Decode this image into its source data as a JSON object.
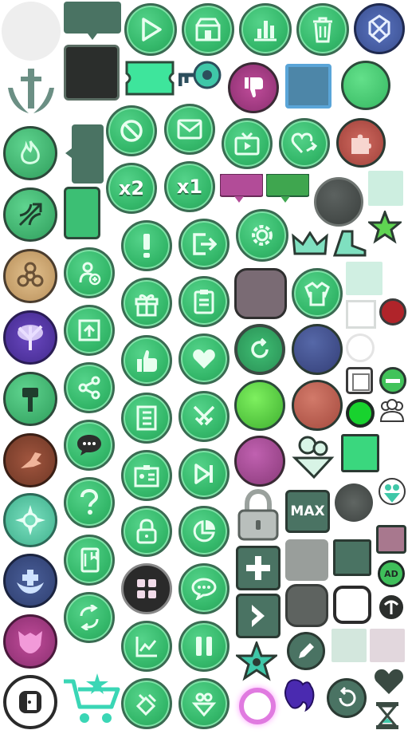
{
  "labels": {
    "x2": "x2",
    "x1": "x1",
    "max": "MAX",
    "ad": "AD"
  },
  "colors": {
    "green": "#3cbf74",
    "green_border": "#3a6b52",
    "dark_slate": "#4a7363",
    "charcoal": "#2b2e2c",
    "magenta": "#b24c98",
    "blue_frame": "#5aa5d8",
    "red_puzzle": "#c45a50",
    "tan": "#caa877",
    "purple": "#5a3aa8",
    "brown": "#8a4a35",
    "teal": "#5bc9a8",
    "navy": "#40518c",
    "pink": "#e98ad0"
  },
  "icons": [
    "circle-placeholder-icon",
    "sword-emblem-icon",
    "fire-icon",
    "bow-icon",
    "biohazard-icon",
    "tree-icon",
    "hammer-icon",
    "claw-icon",
    "sun-icon",
    "heal-icon",
    "helmet-icon",
    "exit-icon",
    "play-icon",
    "shop-icon",
    "chart-icon",
    "trash-icon",
    "guild-emblem-icon",
    "ticket-icon",
    "key-icon",
    "thumbs-down-icon",
    "ban-icon",
    "mail-icon",
    "tv-icon",
    "share-heart-icon",
    "puzzle-icon",
    "alert-icon",
    "logout-icon",
    "gear-icon",
    "crown-icon",
    "boot-icon",
    "star-icon",
    "add-user-icon",
    "gift-icon",
    "clipboard-icon",
    "jacket-icon",
    "upgrade-icon",
    "thumbs-up-icon",
    "heart-icon",
    "refresh-icon",
    "share-icon",
    "list-icon",
    "swords-icon",
    "chat-icon",
    "question-icon",
    "id-card-icon",
    "skip-icon",
    "book-icon",
    "lock-icon",
    "pie-chart-icon",
    "padlock-icon",
    "sync-icon",
    "grid-icon",
    "dots-chat-icon",
    "plus-icon",
    "cart-icon",
    "stats-icon",
    "pause-icon",
    "arrow-right-icon",
    "pencil-icon",
    "hourglass-icon",
    "party-icon",
    "teammates-icon",
    "undo-icon",
    "pickaxe-icon"
  ]
}
